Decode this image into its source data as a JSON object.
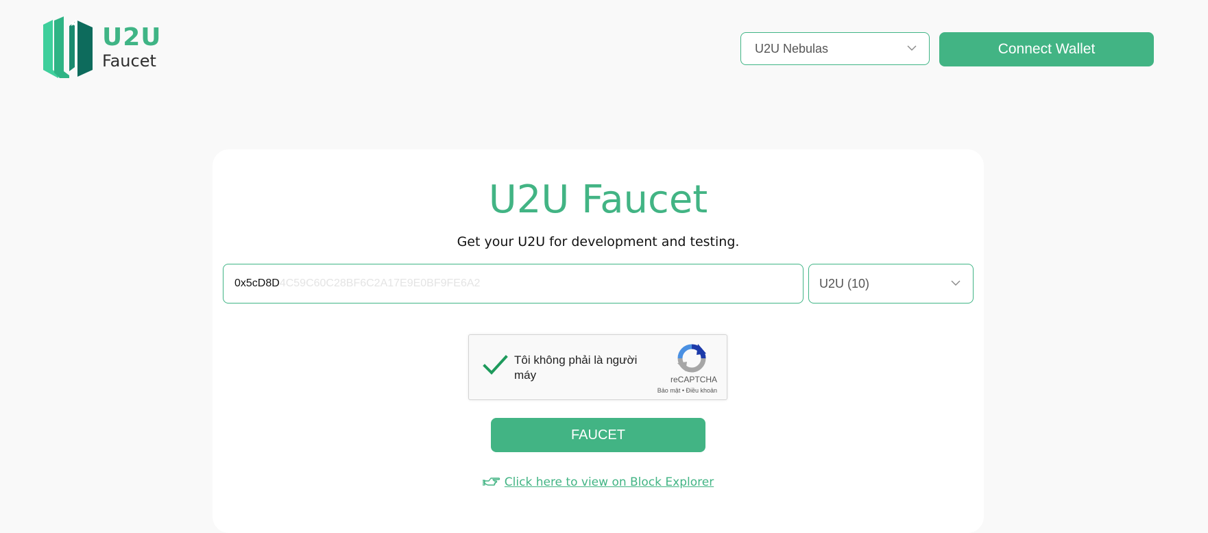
{
  "header": {
    "logo": {
      "title": "U2U",
      "subtitle": "Faucet",
      "icon": "u2u-logo-icon"
    },
    "network_select": {
      "value": "U2U Nebulas",
      "icon": "chevron-down-icon"
    },
    "connect_button_label": "Connect Wallet"
  },
  "card": {
    "title": "U2U Faucet",
    "subtitle": "Get your U2U for development and testing.",
    "address_input": {
      "value_prefix": "0x5cD8D",
      "value_rest": "4C59C60C28BF6C2A17E9E0BF9FE6A2"
    },
    "token_select": {
      "value": "U2U (10)",
      "icon": "chevron-down-icon"
    },
    "recaptcha": {
      "label": "Tôi không phải là người máy",
      "brand": "reCAPTCHA",
      "links": "Bảo mật • Điều khoản",
      "checked": true
    },
    "faucet_button_label": "FAUCET",
    "explorer_link": {
      "text": "Click here to view on Block Explorer",
      "icon": "pointing-hand-icon"
    }
  },
  "colors": {
    "accent": "#42b484",
    "background": "#f9f9f9",
    "card": "#ffffff",
    "logo_dark": "#0d6b5c"
  }
}
